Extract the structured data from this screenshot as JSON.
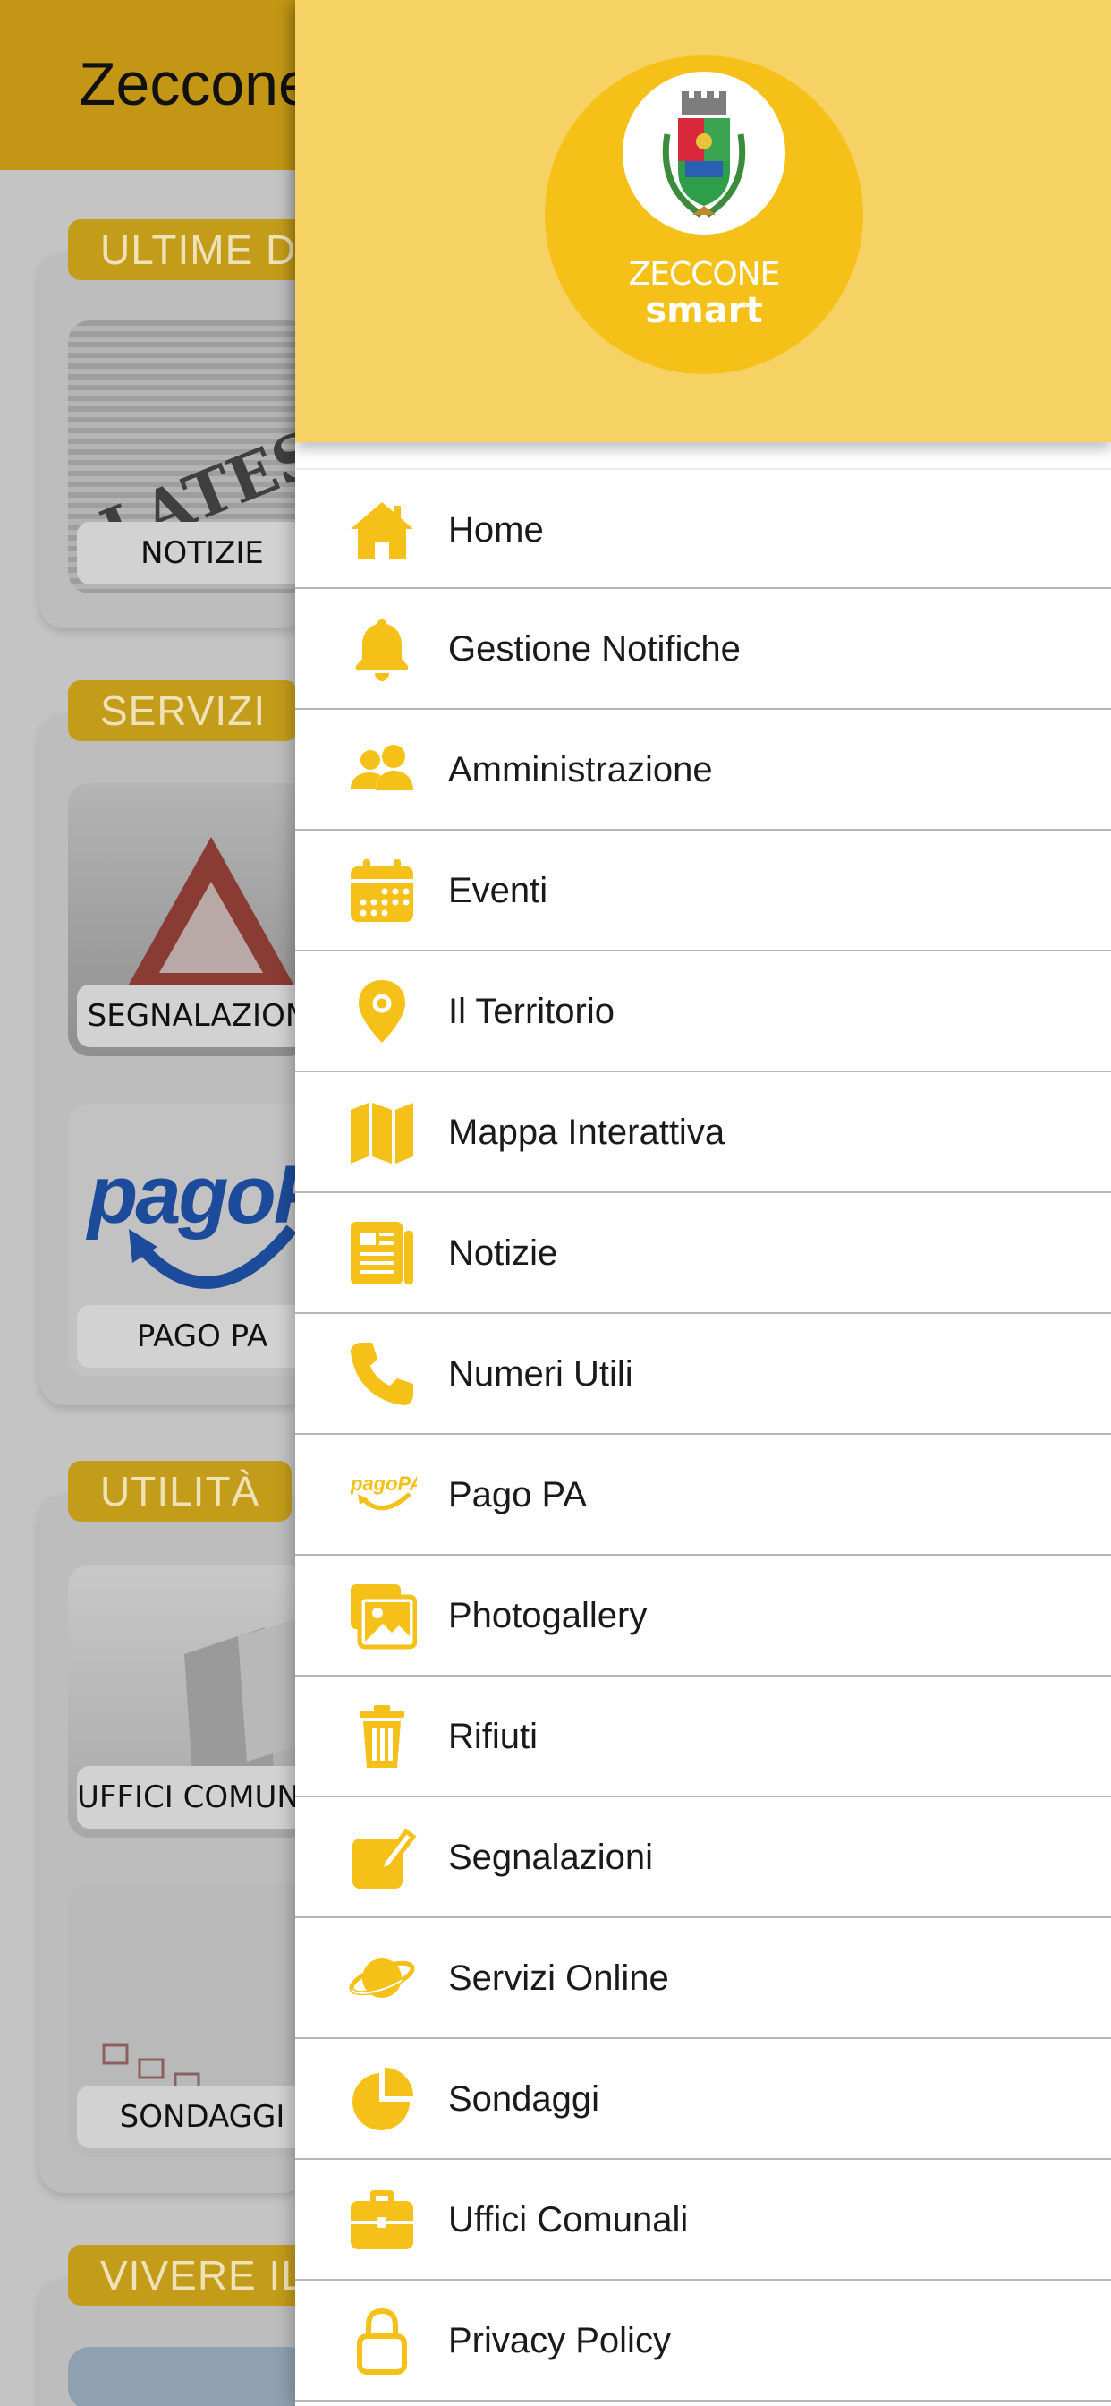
{
  "app": {
    "title": "Zeccone Smart",
    "accent": "#f5c119"
  },
  "sections": [
    {
      "title": "ULTIME DAL COMUNE",
      "tiles": [
        {
          "label": "NOTIZIE"
        }
      ]
    },
    {
      "title": "SERVIZI",
      "tiles": [
        {
          "label": "SEGNALAZIONI"
        },
        {
          "label": "PAGO PA"
        }
      ]
    },
    {
      "title": "UTILITÀ",
      "tiles": [
        {
          "label": "UFFICI COMUNALI"
        },
        {
          "label": "SONDAGGI"
        }
      ]
    },
    {
      "title": "VIVERE IL COMUNE",
      "tiles": []
    }
  ],
  "tile_art": {
    "news_word": "LATEST NEWS",
    "pago_word": "pagoPA"
  },
  "drawer": {
    "logo": {
      "line1": "ZECCONE",
      "line2": "smart"
    },
    "menu": [
      {
        "label": "Home",
        "icon": "home-icon"
      },
      {
        "label": "Gestione Notifiche",
        "icon": "bell-icon"
      },
      {
        "label": "Amministrazione",
        "icon": "users-icon"
      },
      {
        "label": "Eventi",
        "icon": "calendar-icon"
      },
      {
        "label": "Il Territorio",
        "icon": "map-marker-icon"
      },
      {
        "label": "Mappa Interattiva",
        "icon": "map-icon"
      },
      {
        "label": "Notizie",
        "icon": "newspaper-icon"
      },
      {
        "label": "Numeri Utili",
        "icon": "phone-icon"
      },
      {
        "label": "Pago PA",
        "icon": "pagopa-icon"
      },
      {
        "label": "Photogallery",
        "icon": "images-icon"
      },
      {
        "label": "Rifiuti",
        "icon": "trash-icon"
      },
      {
        "label": "Segnalazioni",
        "icon": "edit-icon"
      },
      {
        "label": "Servizi Online",
        "icon": "globe-icon"
      },
      {
        "label": "Sondaggi",
        "icon": "pie-chart-icon"
      },
      {
        "label": "Uffici Comunali",
        "icon": "briefcase-icon"
      },
      {
        "label": "Privacy Policy",
        "icon": "lock-icon"
      }
    ]
  }
}
